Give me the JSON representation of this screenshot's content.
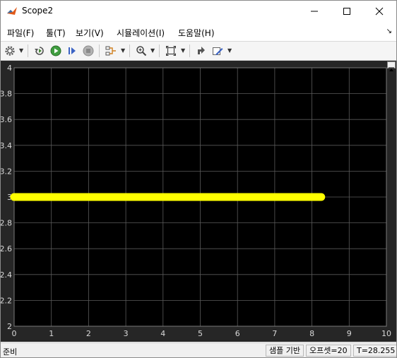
{
  "window": {
    "title": "Scope2"
  },
  "menu": {
    "items": [
      "파일(F)",
      "툴(T)",
      "보기(V)",
      "시뮬레이션(I)",
      "도움말(H)"
    ],
    "overflow_glyph": "↘"
  },
  "toolbar": {
    "items": [
      "settings-gear-icon",
      "step-back-icon",
      "run-icon",
      "step-forward-icon",
      "stop-icon",
      "signal-select-icon",
      "zoom-icon",
      "autoscale-icon",
      "highlight-simulink-block-icon",
      "edit-style-icon"
    ]
  },
  "status": {
    "left": "준비",
    "sample_based": "샘플 기반",
    "offset": "오프셋=20",
    "time": "T=28.255"
  },
  "colors": {
    "plot_bg": "#000000",
    "panel_bg": "#262626",
    "grid": "#5a5a5a",
    "tick_label": "#d9d9d9",
    "signal": "#ffff00"
  },
  "chart_data": {
    "type": "line",
    "title": "",
    "xlabel": "",
    "ylabel": "",
    "xlim": [
      0,
      10
    ],
    "ylim": [
      2,
      4
    ],
    "x_ticks": [
      0,
      1,
      2,
      3,
      4,
      5,
      6,
      7,
      8,
      9,
      10
    ],
    "x_tick_labels": [
      "0",
      "1",
      "2",
      "3",
      "4",
      "5",
      "6",
      "7",
      "8",
      "9",
      "10"
    ],
    "y_ticks": [
      2,
      2.2,
      2.4,
      2.6,
      2.8,
      3,
      3.2,
      3.4,
      3.6,
      3.8,
      4
    ],
    "y_tick_labels": [
      "2",
      "2.2",
      "2.4",
      "2.6",
      "2.8",
      "3",
      "3.2",
      "3.4",
      "3.6",
      "3.8",
      "4"
    ],
    "grid": true,
    "series": [
      {
        "color": "#ffff00",
        "x": [
          0,
          8.25
        ],
        "y": [
          3,
          3
        ]
      }
    ]
  }
}
